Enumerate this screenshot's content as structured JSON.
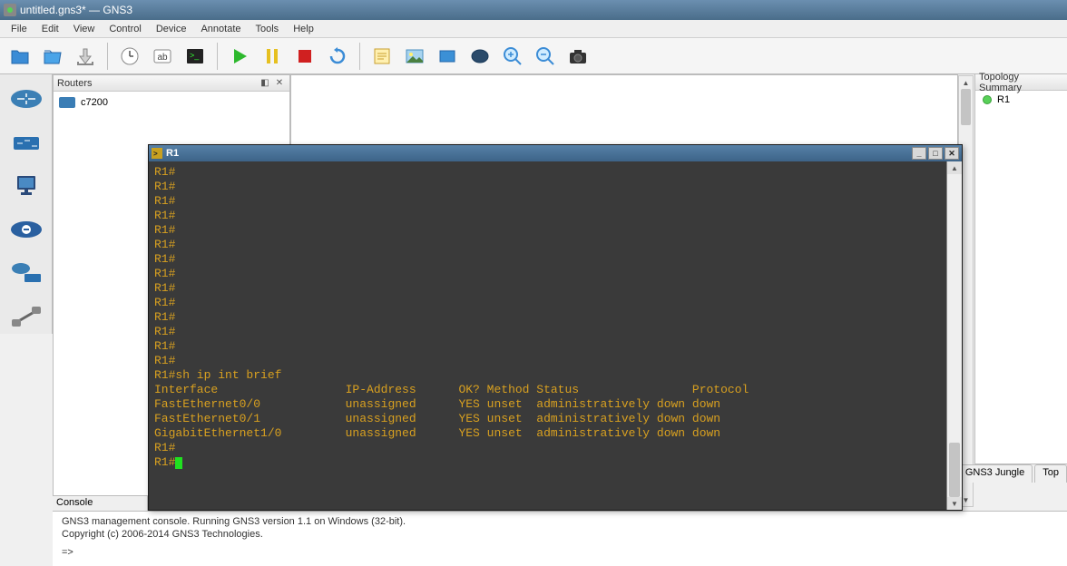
{
  "window": {
    "title": "untitled.gns3* — GNS3"
  },
  "menu": {
    "items": [
      "File",
      "Edit",
      "View",
      "Control",
      "Device",
      "Annotate",
      "Tools",
      "Help"
    ]
  },
  "routers_panel": {
    "title": "Routers",
    "items": [
      {
        "label": "c7200"
      }
    ]
  },
  "topology_panel": {
    "title": "Topology Summary",
    "nodes": [
      {
        "label": "R1",
        "status": "running"
      }
    ]
  },
  "bottom_tabs": {
    "items": [
      "GNS3 Jungle",
      "Top"
    ]
  },
  "terminal": {
    "title": "R1",
    "lines": [
      "R1#",
      "R1#",
      "R1#",
      "R1#",
      "R1#",
      "R1#",
      "R1#",
      "R1#",
      "R1#",
      "R1#",
      "R1#",
      "R1#",
      "R1#",
      "R1#",
      "R1#sh ip int brief",
      "Interface                  IP-Address      OK? Method Status                Protocol",
      "FastEthernet0/0            unassigned      YES unset  administratively down down",
      "FastEthernet0/1            unassigned      YES unset  administratively down down",
      "GigabitEthernet1/0         unassigned      YES unset  administratively down down",
      "R1#",
      "R1#"
    ],
    "prompt_last": "R1#"
  },
  "console": {
    "label": "Console",
    "line1": "GNS3 management console. Running GNS3 version 1.1 on Windows (32-bit).",
    "line2": "Copyright (c) 2006-2014 GNS3 Technologies.",
    "prompt": "=>"
  }
}
